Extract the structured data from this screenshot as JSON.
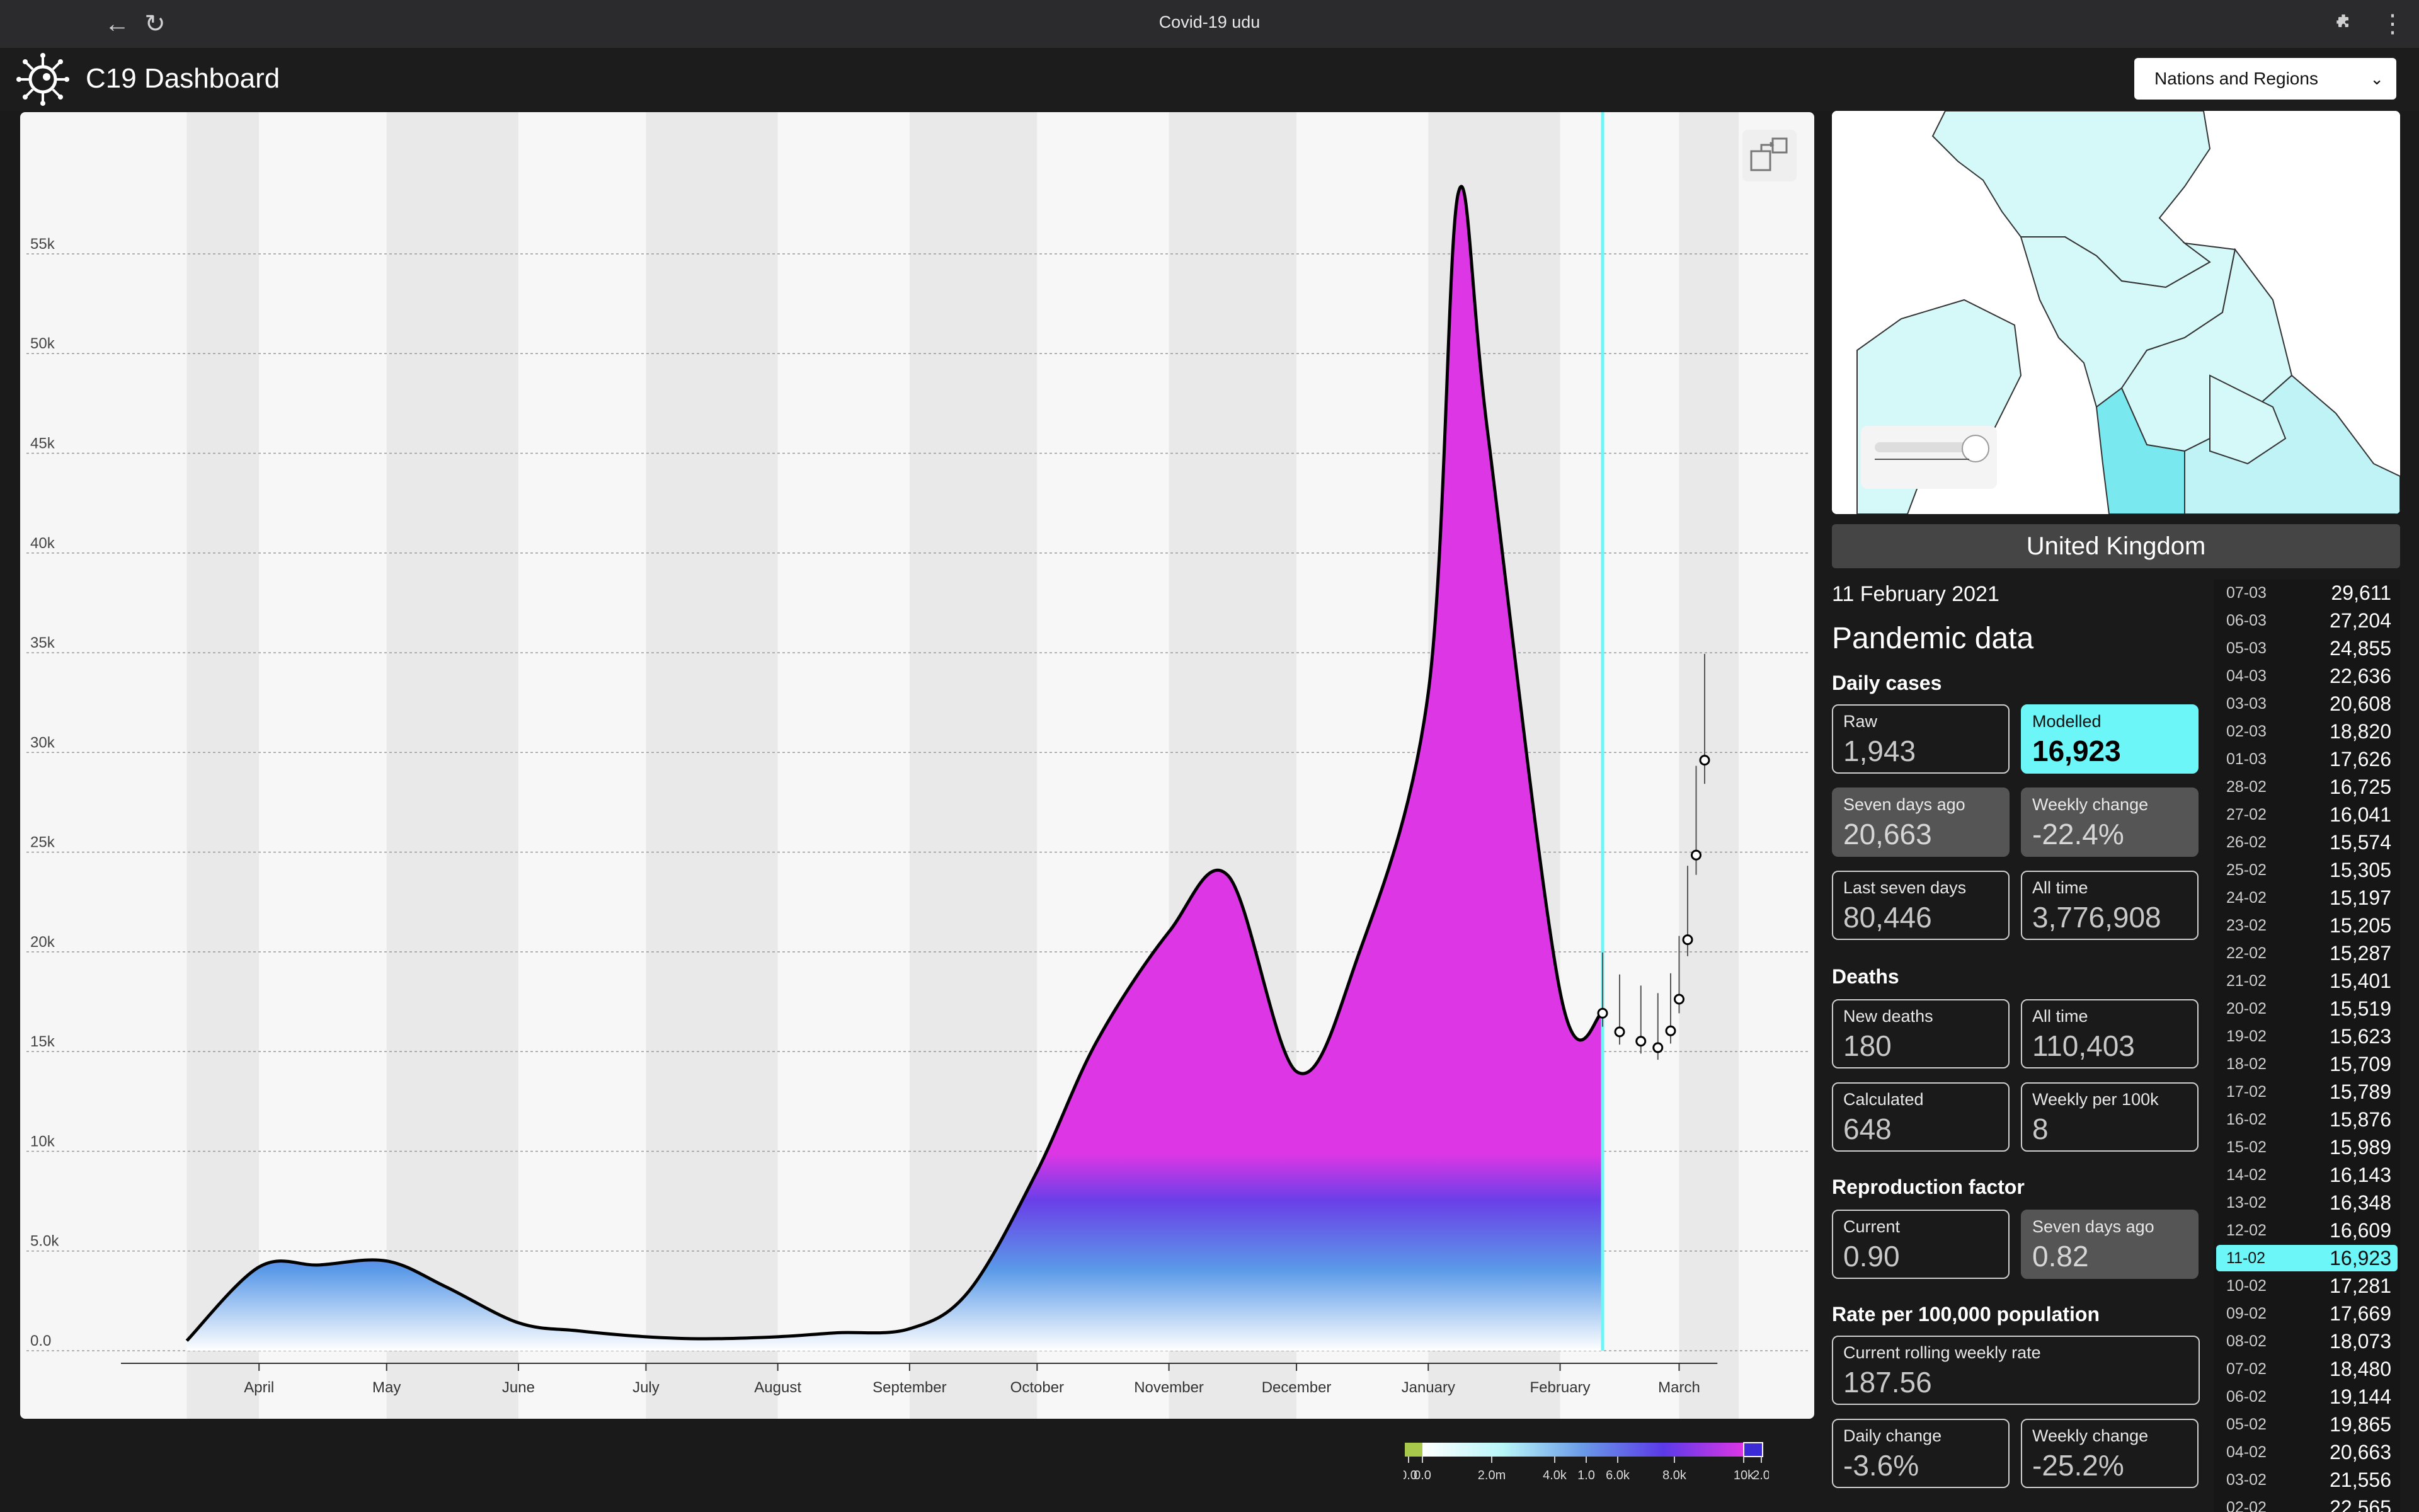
{
  "window": {
    "title": "Covid-19 udu"
  },
  "app": {
    "title": "C19 Dashboard"
  },
  "region_select": {
    "selected": "Nations and Regions"
  },
  "icons": [
    "back-arrow-icon",
    "reload-icon",
    "puzzle-icon",
    "more-vertical-icon",
    "virus-logo-icon",
    "fullscreen-icon",
    "chevron-down-icon"
  ],
  "colors": {
    "modelled": "#6df6f7",
    "fill_high": "#dd36e5",
    "fill_mid": "#6a3fe8",
    "fill_low": "#9ff0f6",
    "map_land": "#d5f8f9"
  },
  "chart_data": {
    "type": "area",
    "title": "",
    "x_labels": [
      "April",
      "May",
      "June",
      "July",
      "August",
      "September",
      "October",
      "November",
      "December",
      "January",
      "February",
      "March"
    ],
    "y_ticks": [
      "0.0",
      "5.0k",
      "10k",
      "15k",
      "20k",
      "25k",
      "30k",
      "35k",
      "40k",
      "45k",
      "50k",
      "55k"
    ],
    "ylim": [
      0,
      58000
    ],
    "series": [
      {
        "name": "",
        "dates": [
          "2020-03-15",
          "2020-04-01",
          "2020-04-15",
          "2020-05-01",
          "2020-05-15",
          "2020-06-01",
          "2020-06-15",
          "2020-07-01",
          "2020-07-15",
          "2020-08-01",
          "2020-08-15",
          "2020-09-01",
          "2020-09-15",
          "2020-10-01",
          "2020-10-15",
          "2020-11-01",
          "2020-11-15",
          "2020-12-01",
          "2020-12-15",
          "2021-01-01",
          "2021-01-08",
          "2021-01-15",
          "2021-02-01",
          "2021-02-11"
        ],
        "values": [
          500,
          4200,
          4300,
          4500,
          3200,
          1400,
          1000,
          700,
          600,
          700,
          900,
          1100,
          3000,
          9000,
          15500,
          21000,
          23800,
          14000,
          19500,
          33000,
          58000,
          46000,
          18000,
          16923
        ]
      },
      {
        "name": "projection",
        "dates": [
          "2021-02-11",
          "2021-02-15",
          "2021-02-20",
          "2021-02-24",
          "2021-02-27",
          "2021-03-01",
          "2021-03-03",
          "2021-03-05",
          "2021-03-07"
        ],
        "values": [
          16923,
          15989,
          15519,
          15197,
          16041,
          17626,
          20608,
          24855,
          29611
        ]
      }
    ],
    "marker_date": "2021-02-11"
  },
  "map": {
    "slider_label": ""
  },
  "region": {
    "name": "United Kingdom"
  },
  "panel": {
    "date": "11 February 2021",
    "heading": "Pandemic data",
    "daily_cases": {
      "title": "Daily cases",
      "raw": {
        "label": "Raw",
        "value": "1,943"
      },
      "modelled": {
        "label": "Modelled",
        "value": "16,923"
      },
      "seven_days_ago": {
        "label": "Seven days ago",
        "value": "20,663"
      },
      "weekly_change": {
        "label": "Weekly change",
        "value": "-22.4%"
      },
      "last_seven": {
        "label": "Last seven days",
        "value": "80,446"
      },
      "all_time": {
        "label": "All time",
        "value": "3,776,908"
      }
    },
    "deaths": {
      "title": "Deaths",
      "new": {
        "label": "New deaths",
        "value": "180"
      },
      "all_time": {
        "label": "All time",
        "value": "110,403"
      },
      "calculated": {
        "label": "Calculated",
        "value": "648"
      },
      "weekly_per_100k": {
        "label": "Weekly per 100k",
        "value": "8"
      }
    },
    "reproduction": {
      "title": "Reproduction factor",
      "current": {
        "label": "Current",
        "value": "0.90"
      },
      "seven_days_ago": {
        "label": "Seven days ago",
        "value": "0.82"
      }
    },
    "rate": {
      "title": "Rate per 100,000 population",
      "rolling": {
        "label": "Current rolling weekly rate",
        "value": "187.56"
      },
      "daily_change": {
        "label": "Daily change",
        "value": "-3.6%"
      },
      "weekly_change": {
        "label": "Weekly change",
        "value": "-25.2%"
      }
    }
  },
  "table": {
    "selected": "11-02",
    "rows": [
      [
        "07-03",
        "29,611"
      ],
      [
        "06-03",
        "27,204"
      ],
      [
        "05-03",
        "24,855"
      ],
      [
        "04-03",
        "22,636"
      ],
      [
        "03-03",
        "20,608"
      ],
      [
        "02-03",
        "18,820"
      ],
      [
        "01-03",
        "17,626"
      ],
      [
        "28-02",
        "16,725"
      ],
      [
        "27-02",
        "16,041"
      ],
      [
        "26-02",
        "15,574"
      ],
      [
        "25-02",
        "15,305"
      ],
      [
        "24-02",
        "15,197"
      ],
      [
        "23-02",
        "15,205"
      ],
      [
        "22-02",
        "15,287"
      ],
      [
        "21-02",
        "15,401"
      ],
      [
        "20-02",
        "15,519"
      ],
      [
        "19-02",
        "15,623"
      ],
      [
        "18-02",
        "15,709"
      ],
      [
        "17-02",
        "15,789"
      ],
      [
        "16-02",
        "15,876"
      ],
      [
        "15-02",
        "15,989"
      ],
      [
        "14-02",
        "16,143"
      ],
      [
        "13-02",
        "16,348"
      ],
      [
        "12-02",
        "16,609"
      ],
      [
        "11-02",
        "16,923"
      ],
      [
        "10-02",
        "17,281"
      ],
      [
        "09-02",
        "17,669"
      ],
      [
        "08-02",
        "18,073"
      ],
      [
        "07-02",
        "18,480"
      ],
      [
        "06-02",
        "19,144"
      ],
      [
        "05-02",
        "19,865"
      ],
      [
        "04-02",
        "20,663"
      ],
      [
        "03-02",
        "21,556"
      ],
      [
        "02-02",
        "22,565"
      ]
    ]
  },
  "legend": {
    "ticks": [
      "0.0",
      "0.0",
      "2.0m",
      "4.0k",
      "1.0",
      "6.0k",
      "8.0k",
      "10k",
      "2.0"
    ]
  }
}
